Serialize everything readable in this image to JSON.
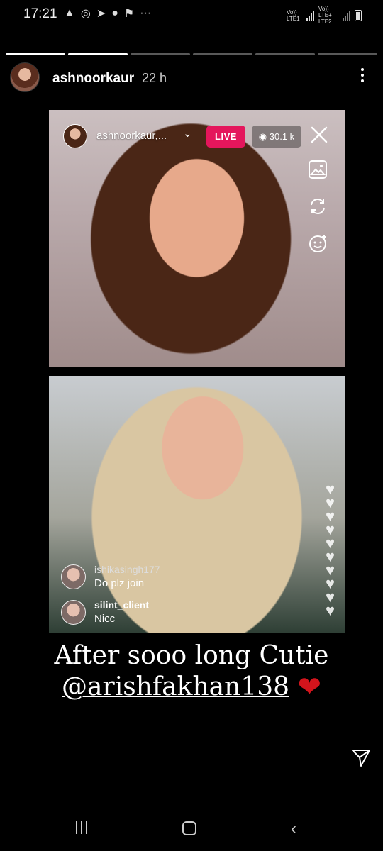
{
  "status_bar": {
    "time": "17:21",
    "icons": [
      "warning-icon",
      "whatsapp-icon",
      "telegram-icon",
      "app-icon",
      "flag-icon",
      "more-notifications-icon"
    ],
    "sim1": "Vo)) LTE1",
    "sim2": "Vo)) LTE+ LTE2",
    "overflow": "···"
  },
  "story": {
    "progress_segments": 6,
    "completed_segments": 2,
    "username": "ashnoorkaur",
    "time_ago": "22 h"
  },
  "live": {
    "host_label": "ashnoorkaur,...",
    "badge": "LIVE",
    "viewers": "30.1 k",
    "comments": [
      {
        "user": "ishikasingh177",
        "text": "Do plz join"
      },
      {
        "user": "silint_client",
        "text": "Nicc"
      }
    ]
  },
  "caption": {
    "line1": "After sooo long Cutie",
    "mention": "@arishfakhan138",
    "emoji": "❤"
  },
  "colors": {
    "live_badge": "#e4165c",
    "heart": "#d3141c"
  }
}
